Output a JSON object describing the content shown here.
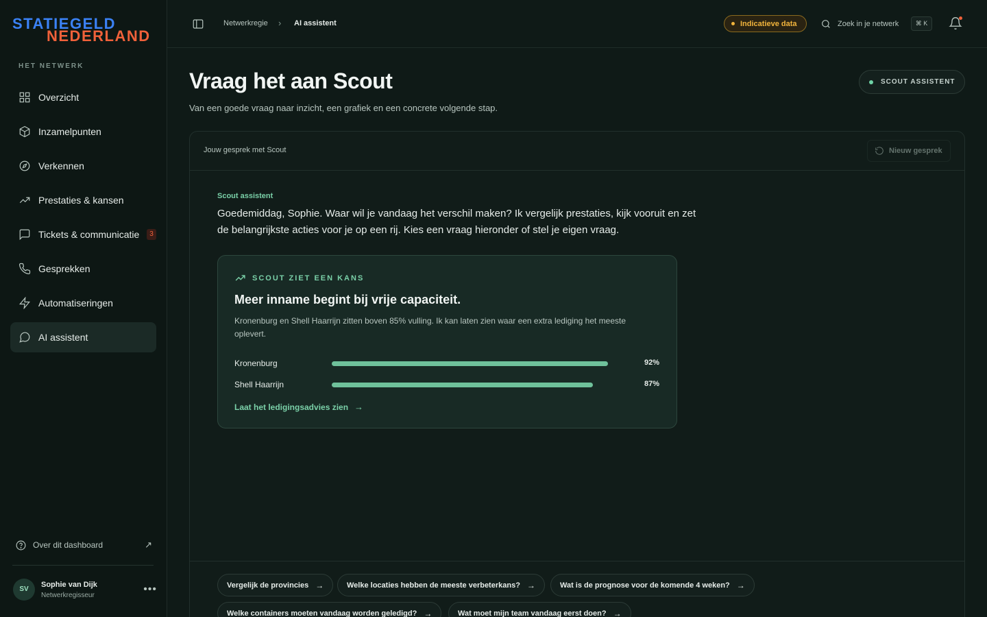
{
  "brand": {
    "line1": "STATIEGELD",
    "line2": "NEDERLAND"
  },
  "sidebar": {
    "section_title": "HET NETWERK",
    "items": [
      {
        "label": "Overzicht",
        "icon": "grid-icon"
      },
      {
        "label": "Inzamelpunten",
        "icon": "box-icon"
      },
      {
        "label": "Verkennen",
        "icon": "compass-icon"
      },
      {
        "label": "Prestaties & kansen",
        "icon": "trending-up-icon"
      },
      {
        "label": "Tickets & communicatie",
        "icon": "message-square-icon",
        "count": "3"
      },
      {
        "label": "Gesprekken",
        "icon": "phone-icon"
      },
      {
        "label": "Automatiseringen",
        "icon": "zap-icon"
      },
      {
        "label": "AI assistent",
        "icon": "message-circle-icon",
        "active": true
      }
    ],
    "about_label": "Over dit dashboard",
    "user": {
      "initials": "SV",
      "name": "Sophie van Dijk",
      "role": "Netwerkregisseur"
    }
  },
  "topbar": {
    "breadcrumb": [
      "Netwerkregie",
      "AI assistent"
    ],
    "badge": "Indicatieve data",
    "search_placeholder": "Zoek in je netwerk",
    "shortcut": "⌘ K"
  },
  "header": {
    "title": "Vraag het aan Scout",
    "subtitle": "Van een goede vraag naar inzicht, een grafiek en een concrete volgende stap.",
    "pill": "SCOUT ASSISTENT"
  },
  "conversation": {
    "title": "Jouw gesprek met Scout",
    "new_button": "Nieuw gesprek",
    "sender": "Scout assistent",
    "message": "Goedemiddag, Sophie. Waar wil je vandaag het verschil maken? Ik vergelijk prestaties, kijk vooruit en zet de belangrijkste acties voor je op een rij. Kies een vraag hieronder of stel je eigen vraag.",
    "card": {
      "tag": "SCOUT ZIET EEN KANS",
      "heading": "Meer inname begint bij vrije capaciteit.",
      "body": "Kronenburg en Shell Haarrijn zitten boven 85% vulling. Ik kan laten zien waar een extra lediging het meeste oplevert.",
      "bars": [
        {
          "name": "Kronenburg",
          "value": 0.92,
          "label": "92%"
        },
        {
          "name": "Shell Haarrijn",
          "value": 0.87,
          "label": "87%"
        }
      ],
      "link": "Laat het ledigingsadvies zien"
    },
    "suggestions": [
      "Vergelijk de provincies",
      "Welke locaties hebben de meeste verbeterkans?",
      "Wat is de prognose voor de komende 4 weken?",
      "Welke containers moeten vandaag worden geledigd?",
      "Wat moet mijn team vandaag eerst doen?"
    ]
  },
  "colors": {
    "accent": "#6fc19b",
    "brand_blue": "#3b82f6",
    "brand_orange": "#f0613a",
    "warning": "#f2b43c"
  }
}
